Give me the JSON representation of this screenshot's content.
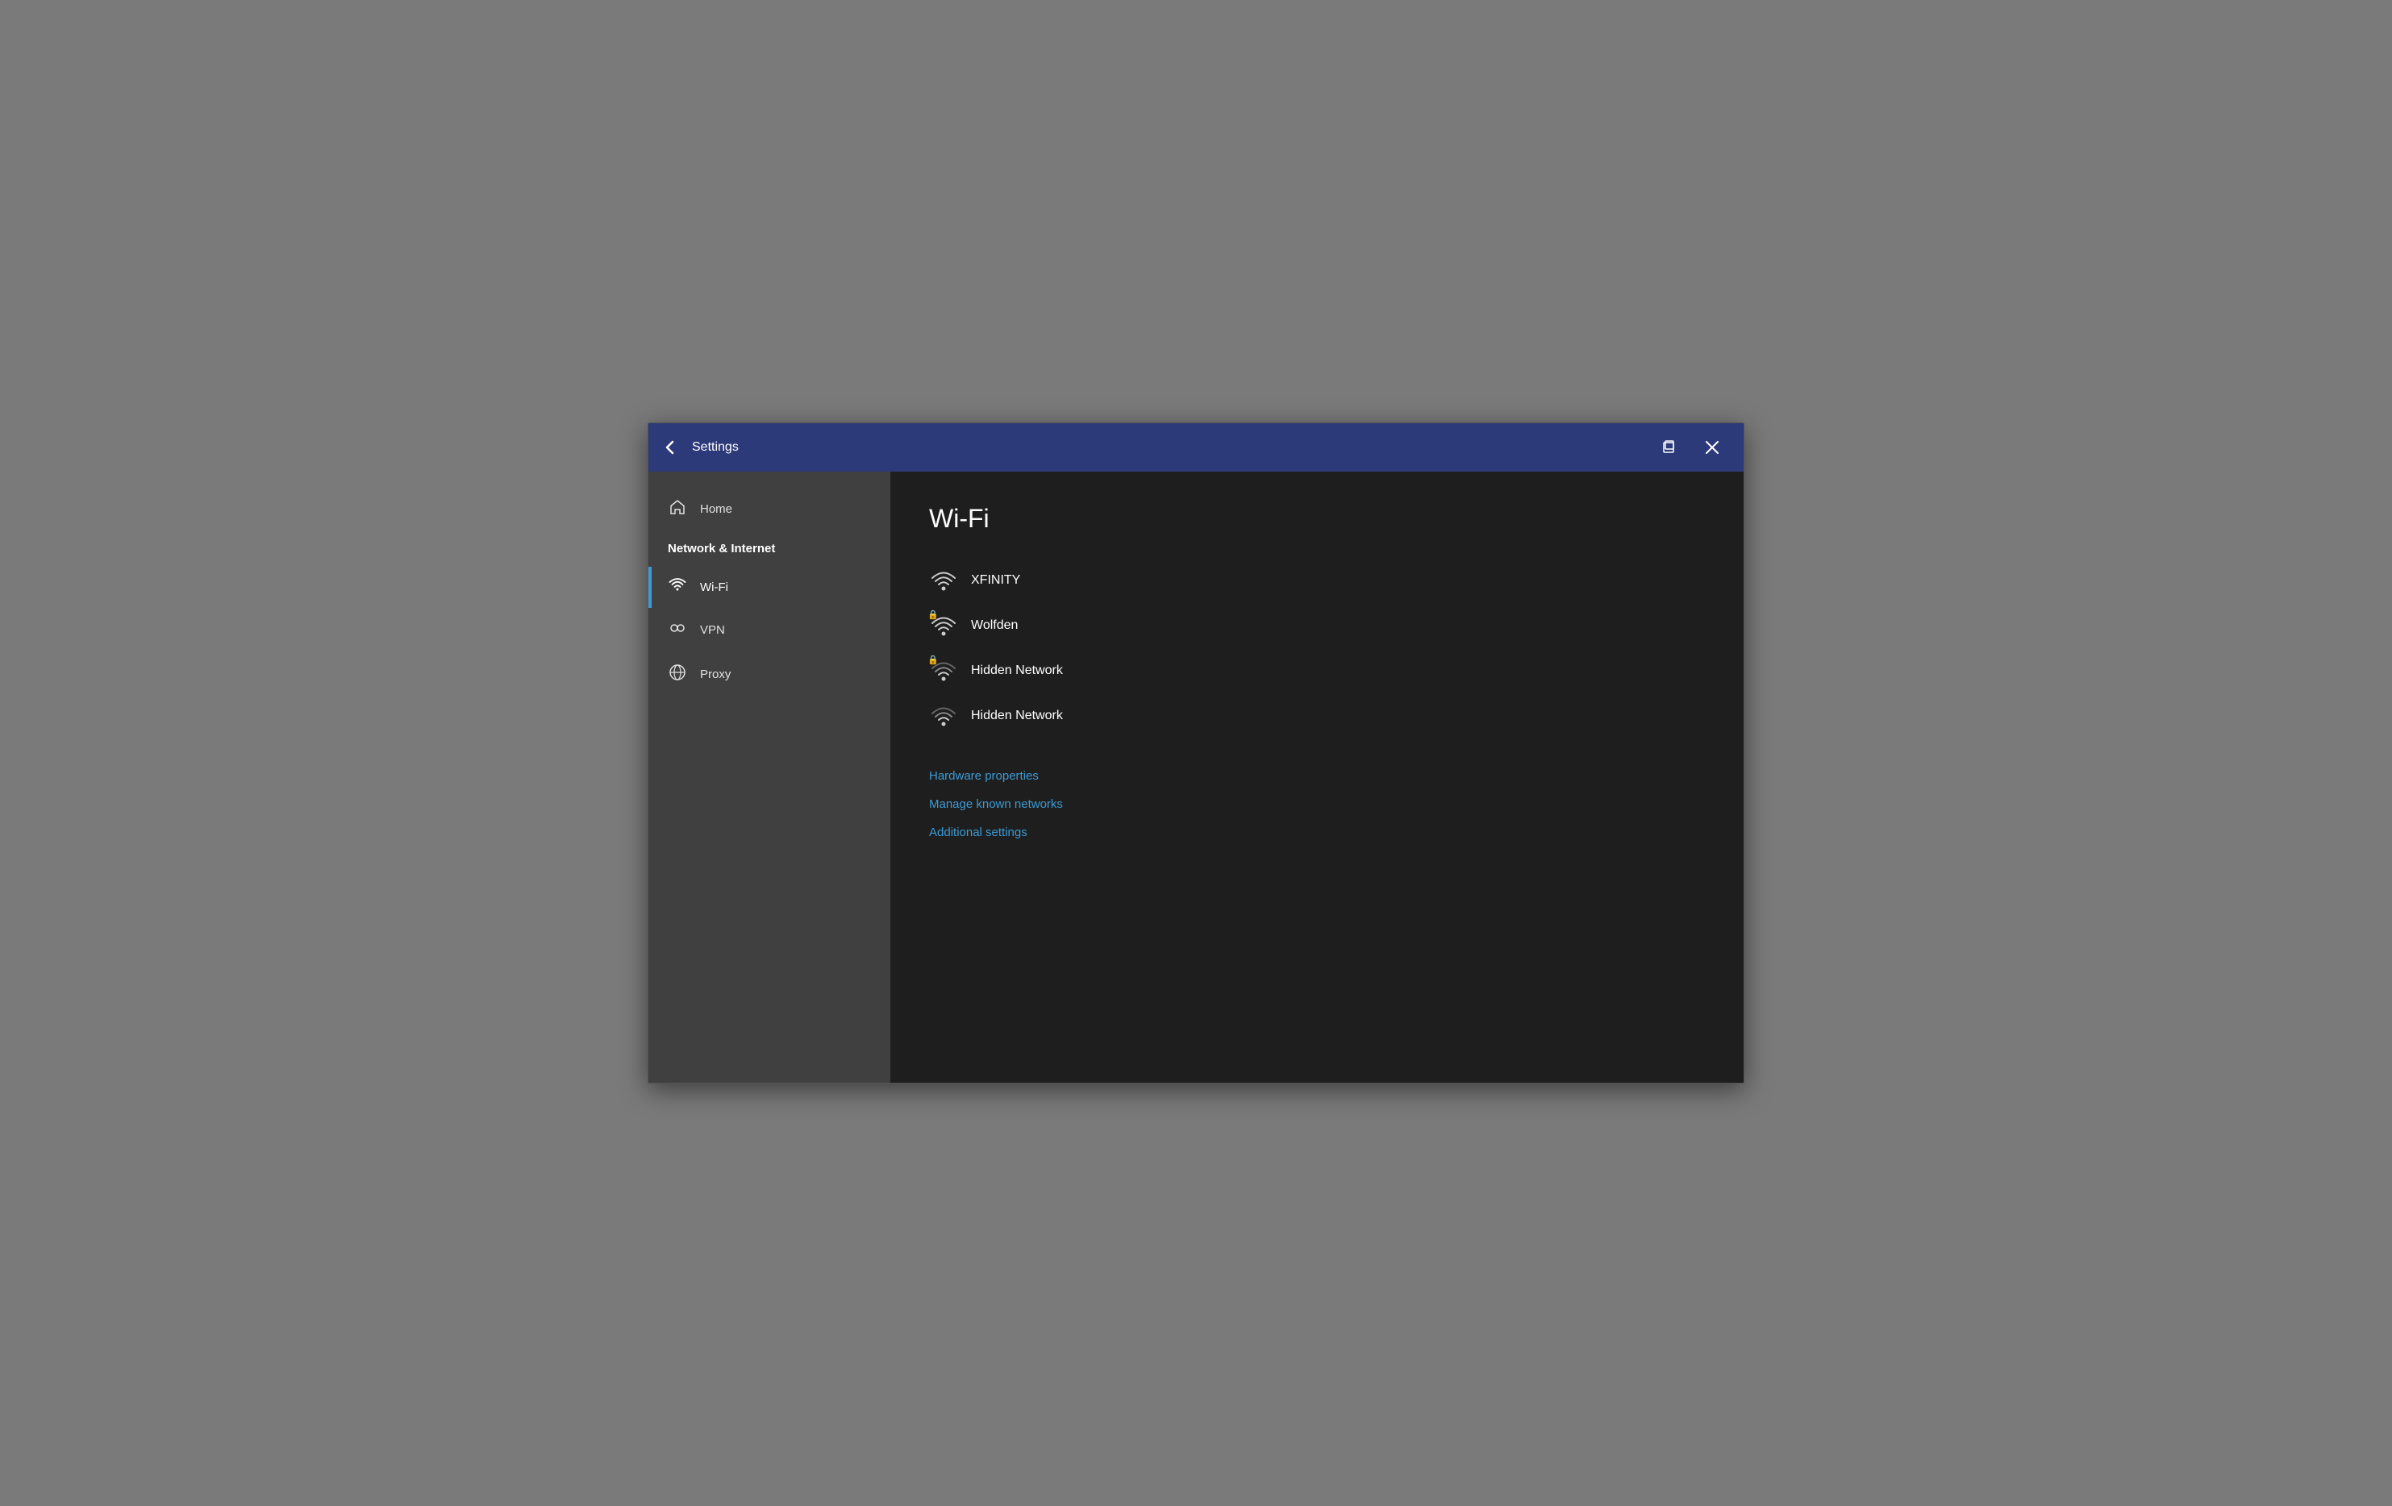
{
  "titlebar": {
    "title": "Settings",
    "back_label": "←",
    "restore_icon": "restore",
    "close_icon": "close"
  },
  "sidebar": {
    "home_label": "Home",
    "section_label": "Network & Internet",
    "items": [
      {
        "id": "wifi",
        "label": "Wi-Fi",
        "active": true
      },
      {
        "id": "vpn",
        "label": "VPN",
        "active": false
      },
      {
        "id": "proxy",
        "label": "Proxy",
        "active": false
      }
    ]
  },
  "content": {
    "title": "Wi-Fi",
    "networks": [
      {
        "id": "xfinity",
        "name": "XFINITY",
        "locked": false,
        "signal": "full"
      },
      {
        "id": "wolfden",
        "name": "Wolfden",
        "locked": true,
        "signal": "full"
      },
      {
        "id": "hidden1",
        "name": "Hidden Network",
        "locked": true,
        "signal": "medium"
      },
      {
        "id": "hidden2",
        "name": "Hidden Network",
        "locked": false,
        "signal": "medium"
      }
    ],
    "links": [
      {
        "id": "hardware",
        "label": "Hardware properties"
      },
      {
        "id": "manage",
        "label": "Manage known networks"
      },
      {
        "id": "additional",
        "label": "Additional settings"
      }
    ]
  }
}
